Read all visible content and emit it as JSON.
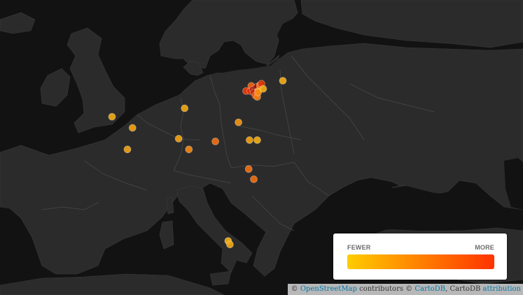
{
  "basemap": {
    "land_color": "#2b2b2c",
    "sea_color": "#121212",
    "border_color": "#4a4a4a"
  },
  "points": [
    {
      "lon": -1.5,
      "lat": 52.4,
      "intensity": 0.22
    },
    {
      "lon": 0.9,
      "lat": 51.6,
      "intensity": 0.3
    },
    {
      "lon": 0.3,
      "lat": 50.0,
      "intensity": 0.28
    },
    {
      "lon": 7.0,
      "lat": 53.0,
      "intensity": 0.25
    },
    {
      "lon": 6.3,
      "lat": 50.8,
      "intensity": 0.3
    },
    {
      "lon": 7.5,
      "lat": 50.0,
      "intensity": 0.45
    },
    {
      "lon": 10.6,
      "lat": 50.6,
      "intensity": 0.55
    },
    {
      "lon": 13.3,
      "lat": 52.0,
      "intensity": 0.4
    },
    {
      "lon": 14.6,
      "lat": 50.7,
      "intensity": 0.3
    },
    {
      "lon": 14.5,
      "lat": 48.5,
      "intensity": 0.55
    },
    {
      "lon": 14.2,
      "lat": 54.2,
      "intensity": 0.75
    },
    {
      "lon": 14.7,
      "lat": 54.2,
      "intensity": 0.8
    },
    {
      "lon": 14.8,
      "lat": 54.55,
      "intensity": 0.6
    },
    {
      "lon": 15.0,
      "lat": 54.3,
      "intensity": 0.9
    },
    {
      "lon": 15.3,
      "lat": 54.4,
      "intensity": 1.0
    },
    {
      "lon": 15.5,
      "lat": 54.5,
      "intensity": 0.95
    },
    {
      "lon": 15.1,
      "lat": 54.1,
      "intensity": 0.85
    },
    {
      "lon": 15.3,
      "lat": 53.9,
      "intensity": 0.7
    },
    {
      "lon": 15.5,
      "lat": 53.8,
      "intensity": 0.5
    },
    {
      "lon": 15.6,
      "lat": 54.2,
      "intensity": 0.35
    },
    {
      "lon": 15.6,
      "lat": 54.1,
      "intensity": 0.45
    },
    {
      "lon": 15.8,
      "lat": 54.6,
      "intensity": 0.5
    },
    {
      "lon": 16.0,
      "lat": 54.7,
      "intensity": 0.8
    },
    {
      "lon": 16.2,
      "lat": 54.35,
      "intensity": 0.2
    },
    {
      "lon": 18.5,
      "lat": 54.9,
      "intensity": 0.2
    },
    {
      "lon": 15.5,
      "lat": 50.7,
      "intensity": 0.2
    },
    {
      "lon": 15.1,
      "lat": 47.7,
      "intensity": 0.55
    },
    {
      "lon": 12.1,
      "lat": 42.6,
      "intensity": 0.2
    },
    {
      "lon": 12.3,
      "lat": 42.3,
      "intensity": 0.25
    }
  ],
  "legend": {
    "low_label": "FEWER",
    "high_label": "MORE",
    "gradient_start": "#ffcc00",
    "gradient_end": "#ff3300"
  },
  "attribution": {
    "copyright": "©",
    "osm_link": "OpenStreetMap",
    "contributors": "contributors ©",
    "carto_link": "CartoDB",
    "carto_text": ", CartoDB",
    "attribution_link": "attribution"
  }
}
